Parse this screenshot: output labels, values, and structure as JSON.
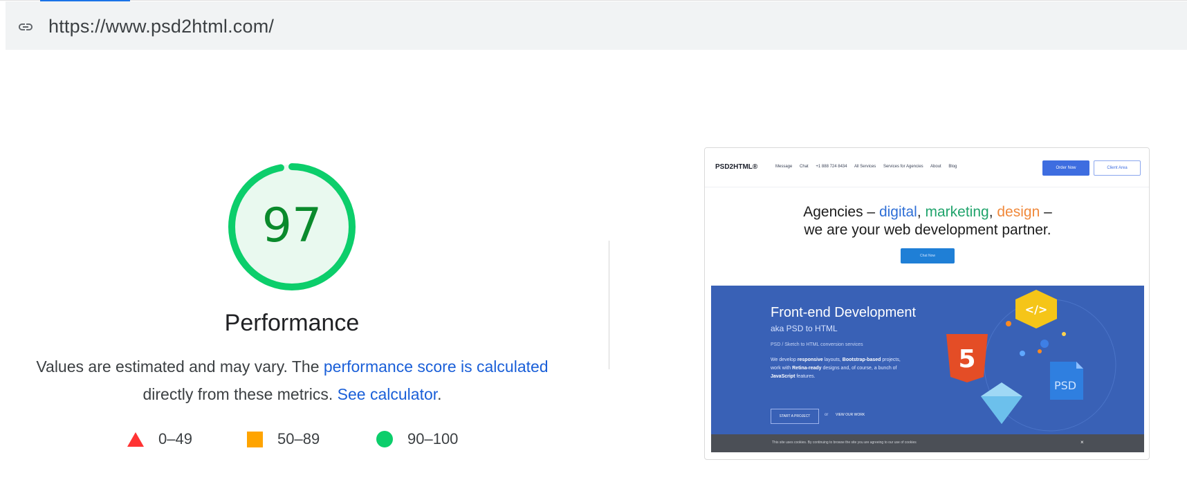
{
  "url_bar": {
    "icon": "link-icon",
    "url": "https://www.psd2html.com/"
  },
  "performance": {
    "score": "97",
    "title": "Performance",
    "description_prefix": "Values are estimated and may vary. The ",
    "score_link_text": "performance score is calculated",
    "description_middle": "directly from these metrics. ",
    "calculator_link_text": "See calculator",
    "description_end": ".",
    "colors": {
      "pass": "#0cce6b",
      "average": "#ffa400",
      "fail": "#ff3333",
      "score_text": "#0a8a2c"
    },
    "legend": [
      {
        "icon": "triangle-icon",
        "range": "0–49"
      },
      {
        "icon": "square-icon",
        "range": "50–89"
      },
      {
        "icon": "circle-icon",
        "range": "90–100"
      }
    ]
  },
  "screenshot": {
    "logo": "PSD2HTML®",
    "nav": [
      "Message",
      "Chat",
      "+1 888 724 8434",
      "All Services",
      "Services for Agencies",
      "About",
      "Blog"
    ],
    "order_button": "Order Now",
    "client_button": "Client Area",
    "hero_line1_prefix": "Agencies – ",
    "hero_digital": "digital",
    "hero_sep1": ", ",
    "hero_marketing": "marketing",
    "hero_sep2": ", ",
    "hero_design": "design",
    "hero_line1_suffix": " –",
    "hero_line2": "we are your web development partner.",
    "cta": "Chat Now",
    "fe_title": "Front-end Development",
    "fe_subtitle": "aka PSD to HTML",
    "fe_p1": "PSD / Sketch to HTML conversion services",
    "fe_p2_a": "We develop ",
    "fe_p2_b": "responsive",
    "fe_p2_c": " layouts, ",
    "fe_p2_d": "Bootstrap-based",
    "fe_p2_e": " projects, work with ",
    "fe_p2_f": "Retina-ready",
    "fe_p2_g": " designs and, of course, a bunch of ",
    "fe_p2_h": "JavaScript",
    "fe_p2_i": " features.",
    "start_button": "START A PROJECT",
    "or": "or",
    "view_work": "VIEW OUR WORK",
    "html5_label": "5",
    "code_label": "</>",
    "psd_label": "PSD",
    "cookie_text": "This site uses cookies. By continuing to browse the site you are agreeing to our use of cookies",
    "cookie_close": "×"
  }
}
